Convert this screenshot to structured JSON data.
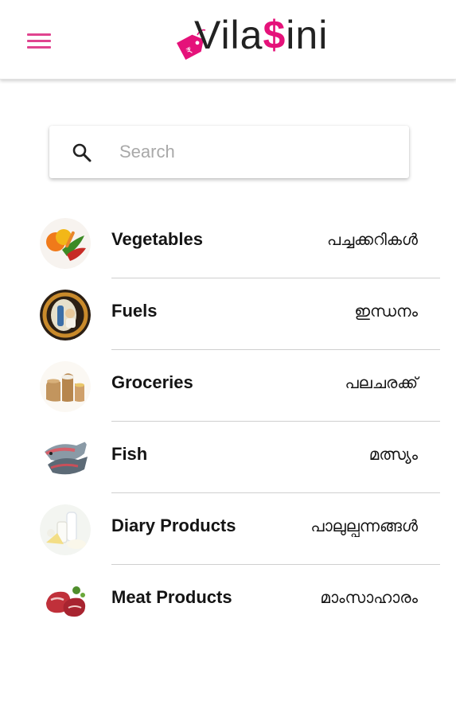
{
  "app": {
    "logo_text_a": "Vila",
    "logo_text_accent": "$",
    "logo_text_b": "ini",
    "logo_tag_symbol": "₹",
    "brand_color": "#e5127a",
    "menu_icon": "hamburger-menu-icon"
  },
  "search": {
    "placeholder": "Search",
    "value": "",
    "icon": "search-icon"
  },
  "categories": [
    {
      "name": "Vegetables",
      "native": "പച്ചക്കറികൾ",
      "icon": "vegetables-image"
    },
    {
      "name": "Fuels",
      "native": "ഇന്ധനം",
      "icon": "fuels-image"
    },
    {
      "name": "Groceries",
      "native": "പലചരക്ക്",
      "icon": "groceries-image"
    },
    {
      "name": "Fish",
      "native": "മത്സ്യം",
      "icon": "fish-image"
    },
    {
      "name": "Diary Products",
      "native": "പാലുല്പന്നങ്ങൾ",
      "icon": "dairy-products-image"
    },
    {
      "name": "Meat Products",
      "native": "മാംസാഹാരം",
      "icon": "meat-products-image"
    }
  ]
}
